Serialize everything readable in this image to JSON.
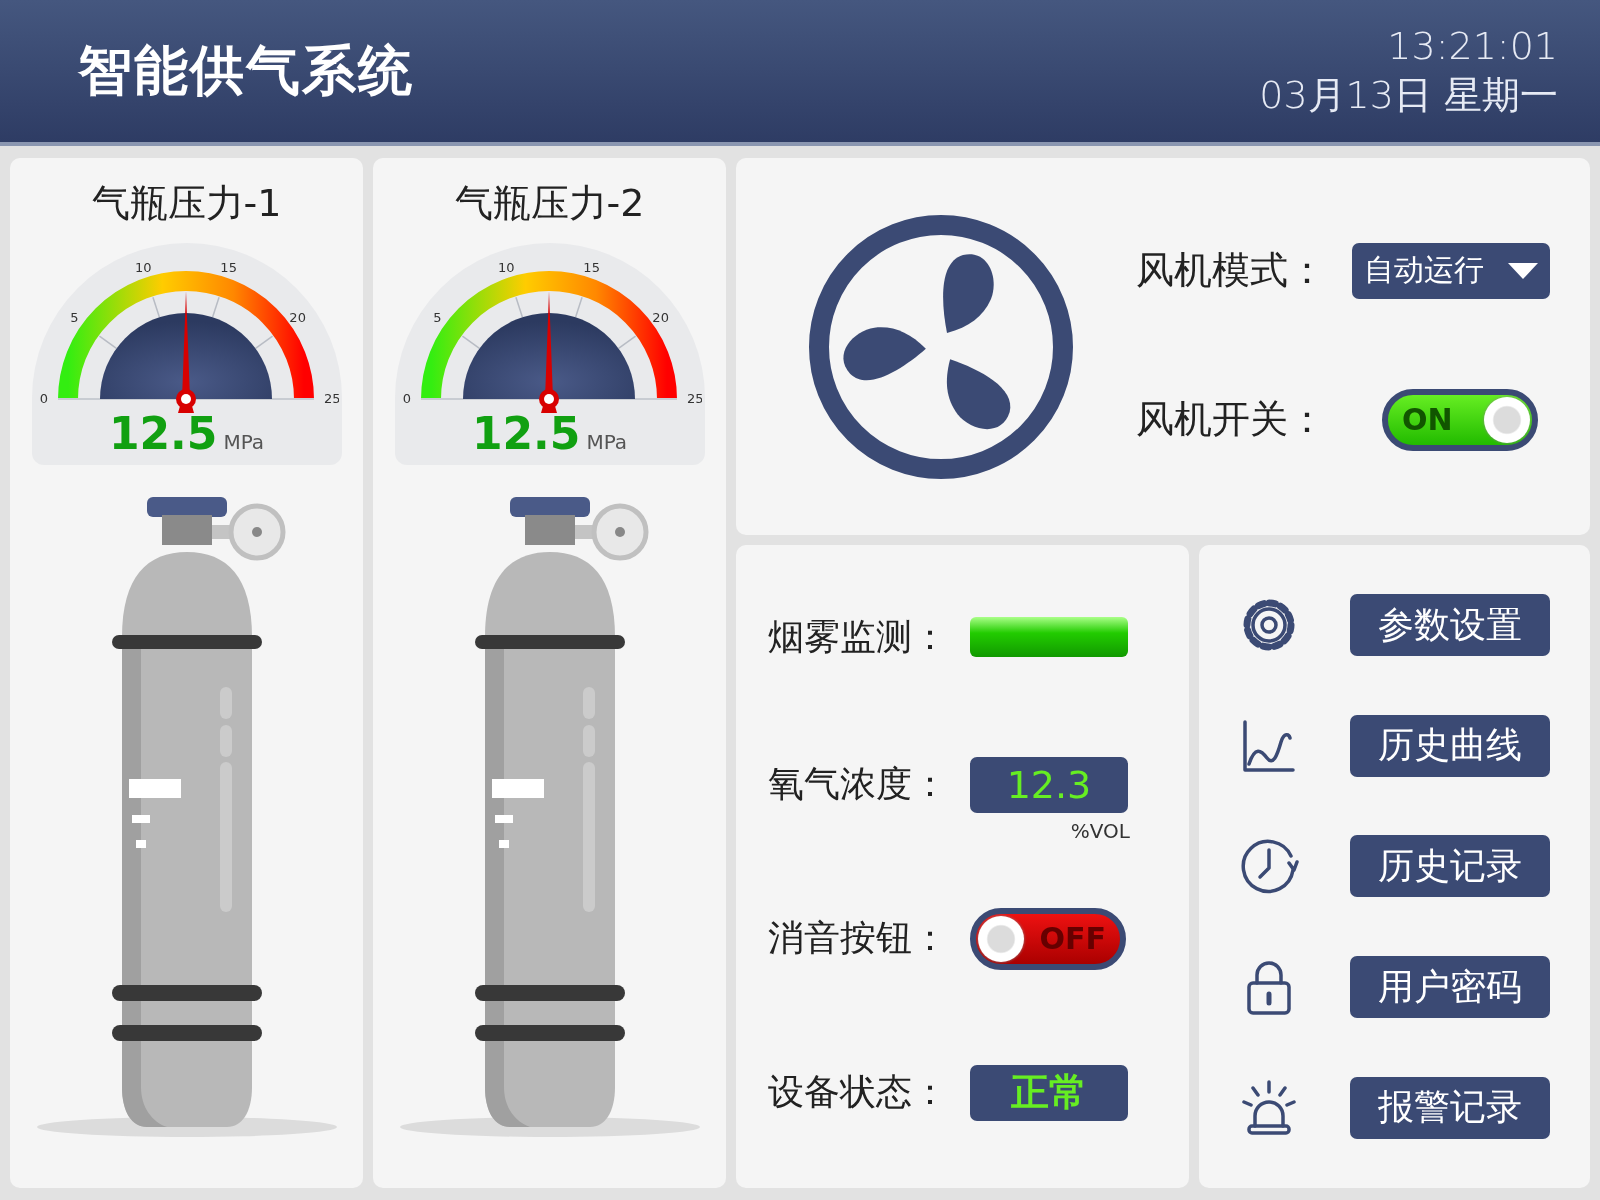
{
  "header": {
    "title": "智能供气系统",
    "time": "13:21:01",
    "date": "03月13日 星期一"
  },
  "cylinders": [
    {
      "title": "气瓶压力-1",
      "ticks": [
        "0",
        "5",
        "10",
        "15",
        "20",
        "25"
      ],
      "level": 0.5,
      "value": "12.5",
      "unit": "MPa"
    },
    {
      "title": "气瓶压力-2",
      "ticks": [
        "0",
        "5",
        "10",
        "15",
        "20",
        "25"
      ],
      "level": 0.5,
      "value": "12.5",
      "unit": "MPa"
    }
  ],
  "fan": {
    "mode_label": "风机模式：",
    "mode_value": "自动运行",
    "switch_label": "风机开关：",
    "switch": {
      "on": true,
      "label": "ON"
    }
  },
  "monitor": {
    "rows": [
      {
        "kind": "indicator",
        "label": "烟雾监测：",
        "on": true
      },
      {
        "kind": "value",
        "label": "氧气浓度：",
        "value": "12.3",
        "unit": "%VOL"
      },
      {
        "kind": "toggle",
        "label": "消音按钮：",
        "on": false,
        "text": "OFF"
      },
      {
        "kind": "status",
        "label": "设备状态：",
        "value": "正常"
      }
    ]
  },
  "menu": [
    {
      "kind": "gear",
      "label": "参数设置"
    },
    {
      "kind": "chart",
      "label": "历史曲线"
    },
    {
      "kind": "clock",
      "label": "历史记录"
    },
    {
      "kind": "lock",
      "label": "用户密码"
    },
    {
      "kind": "alarm",
      "label": "报警记录"
    }
  ]
}
